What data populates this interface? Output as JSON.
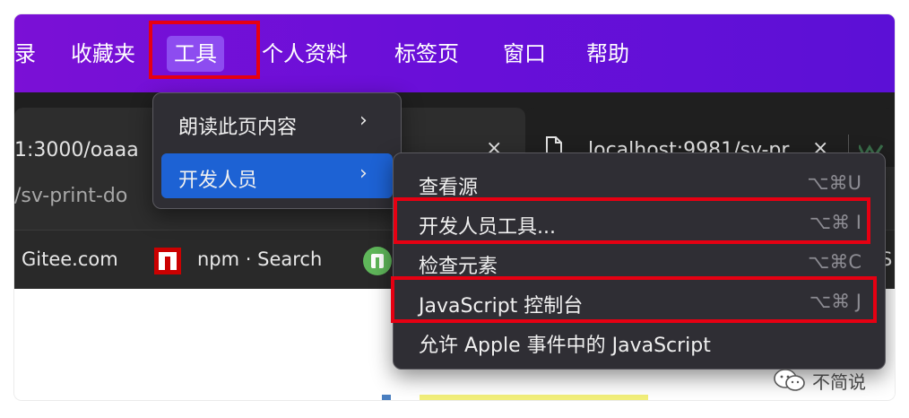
{
  "menubar": {
    "items": [
      {
        "label": "录"
      },
      {
        "label": "收藏夹"
      },
      {
        "label": "工具"
      },
      {
        "label": "个人资料"
      },
      {
        "label": "标签页"
      },
      {
        "label": "窗口"
      },
      {
        "label": "帮助"
      }
    ],
    "active_item": "工具",
    "background": "#6a0fd8"
  },
  "tabs": [
    {
      "title": "1:3000/oaaa",
      "close": "×"
    },
    {
      "title": "localhost:9981/sv-pr",
      "close": "×"
    }
  ],
  "address_bar": {
    "url": "/sv-print-do"
  },
  "bookmarks": [
    {
      "label": "Gitee.com"
    },
    {
      "label": "npm · Search"
    },
    {
      "label": "S"
    }
  ],
  "tools_menu": {
    "items": [
      {
        "label": "朗读此页内容",
        "chevron": "›"
      },
      {
        "label": "开发人员",
        "chevron": "›",
        "selected": true
      }
    ]
  },
  "developer_submenu": {
    "items": [
      {
        "label": "查看源",
        "shortcut": "⌥⌘U"
      },
      {
        "label": "开发人员工具...",
        "shortcut": "⌥⌘ I",
        "highlighted": true
      },
      {
        "label": "检查元素",
        "shortcut": "⌥⌘C"
      },
      {
        "label": "JavaScript 控制台",
        "shortcut": "⌥⌘ J",
        "highlighted": true
      },
      {
        "label": "允许 Apple 事件中的 JavaScript",
        "shortcut": ""
      }
    ]
  },
  "watermark": {
    "text": "不简说",
    "icon": "wechat-icon"
  },
  "colors": {
    "highlight_red": "#e60012",
    "selection_blue": "#1d62d4",
    "menu_bg": "#2f2e34"
  }
}
